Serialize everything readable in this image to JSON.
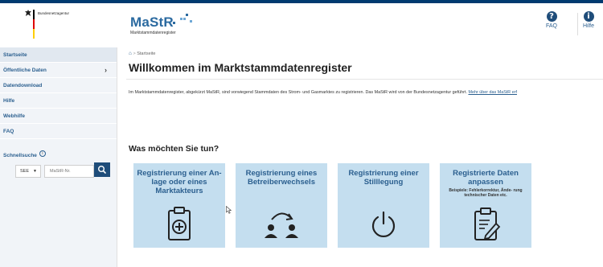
{
  "header": {
    "agency_name": "Bundesnetzagentur",
    "logo_title": "MaStR",
    "logo_subtitle": "Marktstammdatenregister",
    "faq_label": "FAQ",
    "help_label": "Hilfe"
  },
  "sidebar": {
    "items": [
      {
        "label": "Startseite"
      },
      {
        "label": "Öffentliche Daten"
      },
      {
        "label": "Datendownload"
      },
      {
        "label": "Hilfe"
      },
      {
        "label": "Webhilfe"
      },
      {
        "label": "FAQ"
      }
    ],
    "quick_search_label": "Schnellsuche",
    "select_value": "SEE",
    "input_placeholder": "MaStR-Nr."
  },
  "main": {
    "breadcrumb": "Startseite",
    "page_title": "Willkommen im Marktstammdatenregister",
    "intro_text": "Im Marktstammdatenregister, abgekürzt MaStR, sind vorwiegend Stammdaten des Strom- und Gasmarktes zu registrieren. Das MaStR wird von der Bundesnetzagentur geführt.",
    "intro_link": "Mehr über das MaStR erf",
    "section_title": "Was möchten Sie tun?",
    "tiles": [
      {
        "title": "Registrierung einer An- lage oder eines Marktakteurs",
        "icon": "clipboard-plus-icon"
      },
      {
        "title": "Registrierung eines Betreiberwechsels",
        "icon": "owner-change-icon"
      },
      {
        "title": "Registrierung einer Stilllegung",
        "icon": "power-icon"
      },
      {
        "title": "Registrierte Daten anpassen",
        "subtitle": "Beispiele: Fehlerkorrektur, Ände- rung technischer Daten etc.",
        "icon": "clipboard-edit-icon"
      }
    ]
  },
  "colors": {
    "primary": "#2b5f8f",
    "dark_blue": "#1f4d7a",
    "tile_bg": "#c4deef",
    "sidebar_bg": "#f1f4f8"
  }
}
